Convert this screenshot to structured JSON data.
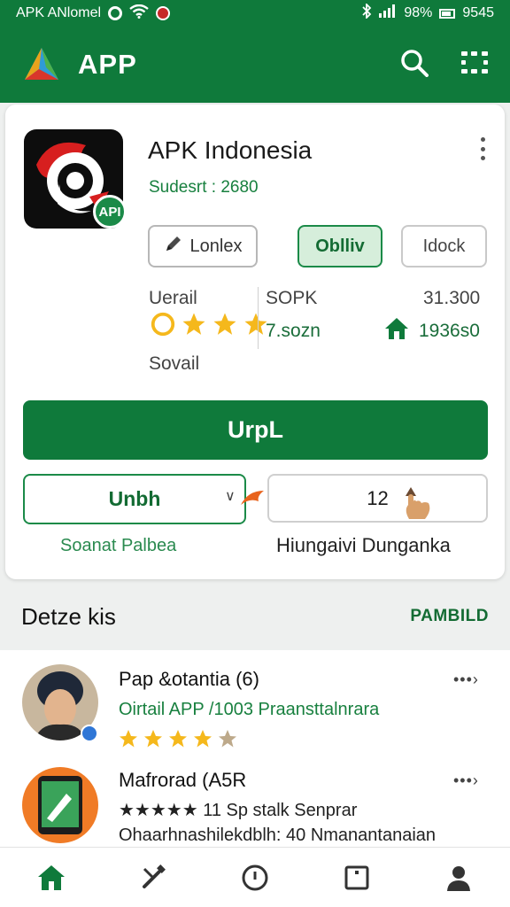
{
  "status_bar": {
    "left_text": "APK ANlomel",
    "battery": "98%",
    "time": "9545"
  },
  "app_bar": {
    "title": "APP"
  },
  "app_card": {
    "name": "APK Indonesia",
    "subtitle": "Sudesrt : 2680",
    "icon_badge": "API",
    "chips": [
      "Lonlex",
      "Oblliv",
      "Idock"
    ],
    "stats": {
      "rating_label": "Uerail",
      "rating_note": "Sovail",
      "size_label": "SOPK",
      "size_value": "7.sozn",
      "downloads_label": "31.300",
      "downloads_value": "1936s0"
    },
    "primary_button": "UrpL",
    "select_button": "Unbh",
    "count_button": "12",
    "footer_left": "Soanat Palbea",
    "footer_right": "Hiungaivi Dunganka"
  },
  "section": {
    "title": "Detze kis",
    "action": "PAMBILD"
  },
  "list": [
    {
      "title": "Pap &otantia (6)",
      "subtitle": "Oirtail APP /1003 Praansttalnrara",
      "rating": 4
    },
    {
      "title": "Mafrorad (A5R",
      "subtitle": "★★★★★ 11 Sp stalk Senprar",
      "detail": "Ohaarhnashilekdblh: 40 Nmanantanaian",
      "rating": 4
    }
  ],
  "colors": {
    "brand": "#0f7a3b",
    "accent_light": "#d6eedb",
    "star": "#f5b81c"
  },
  "icons": [
    "bluetooth-icon",
    "signal-icon",
    "battery-icon",
    "search-icon",
    "grid-icon",
    "kebab-icon",
    "pencil-icon",
    "star-icon",
    "house-icon",
    "home-icon",
    "tools-icon",
    "compass-icon",
    "square-icon",
    "profile-icon"
  ]
}
